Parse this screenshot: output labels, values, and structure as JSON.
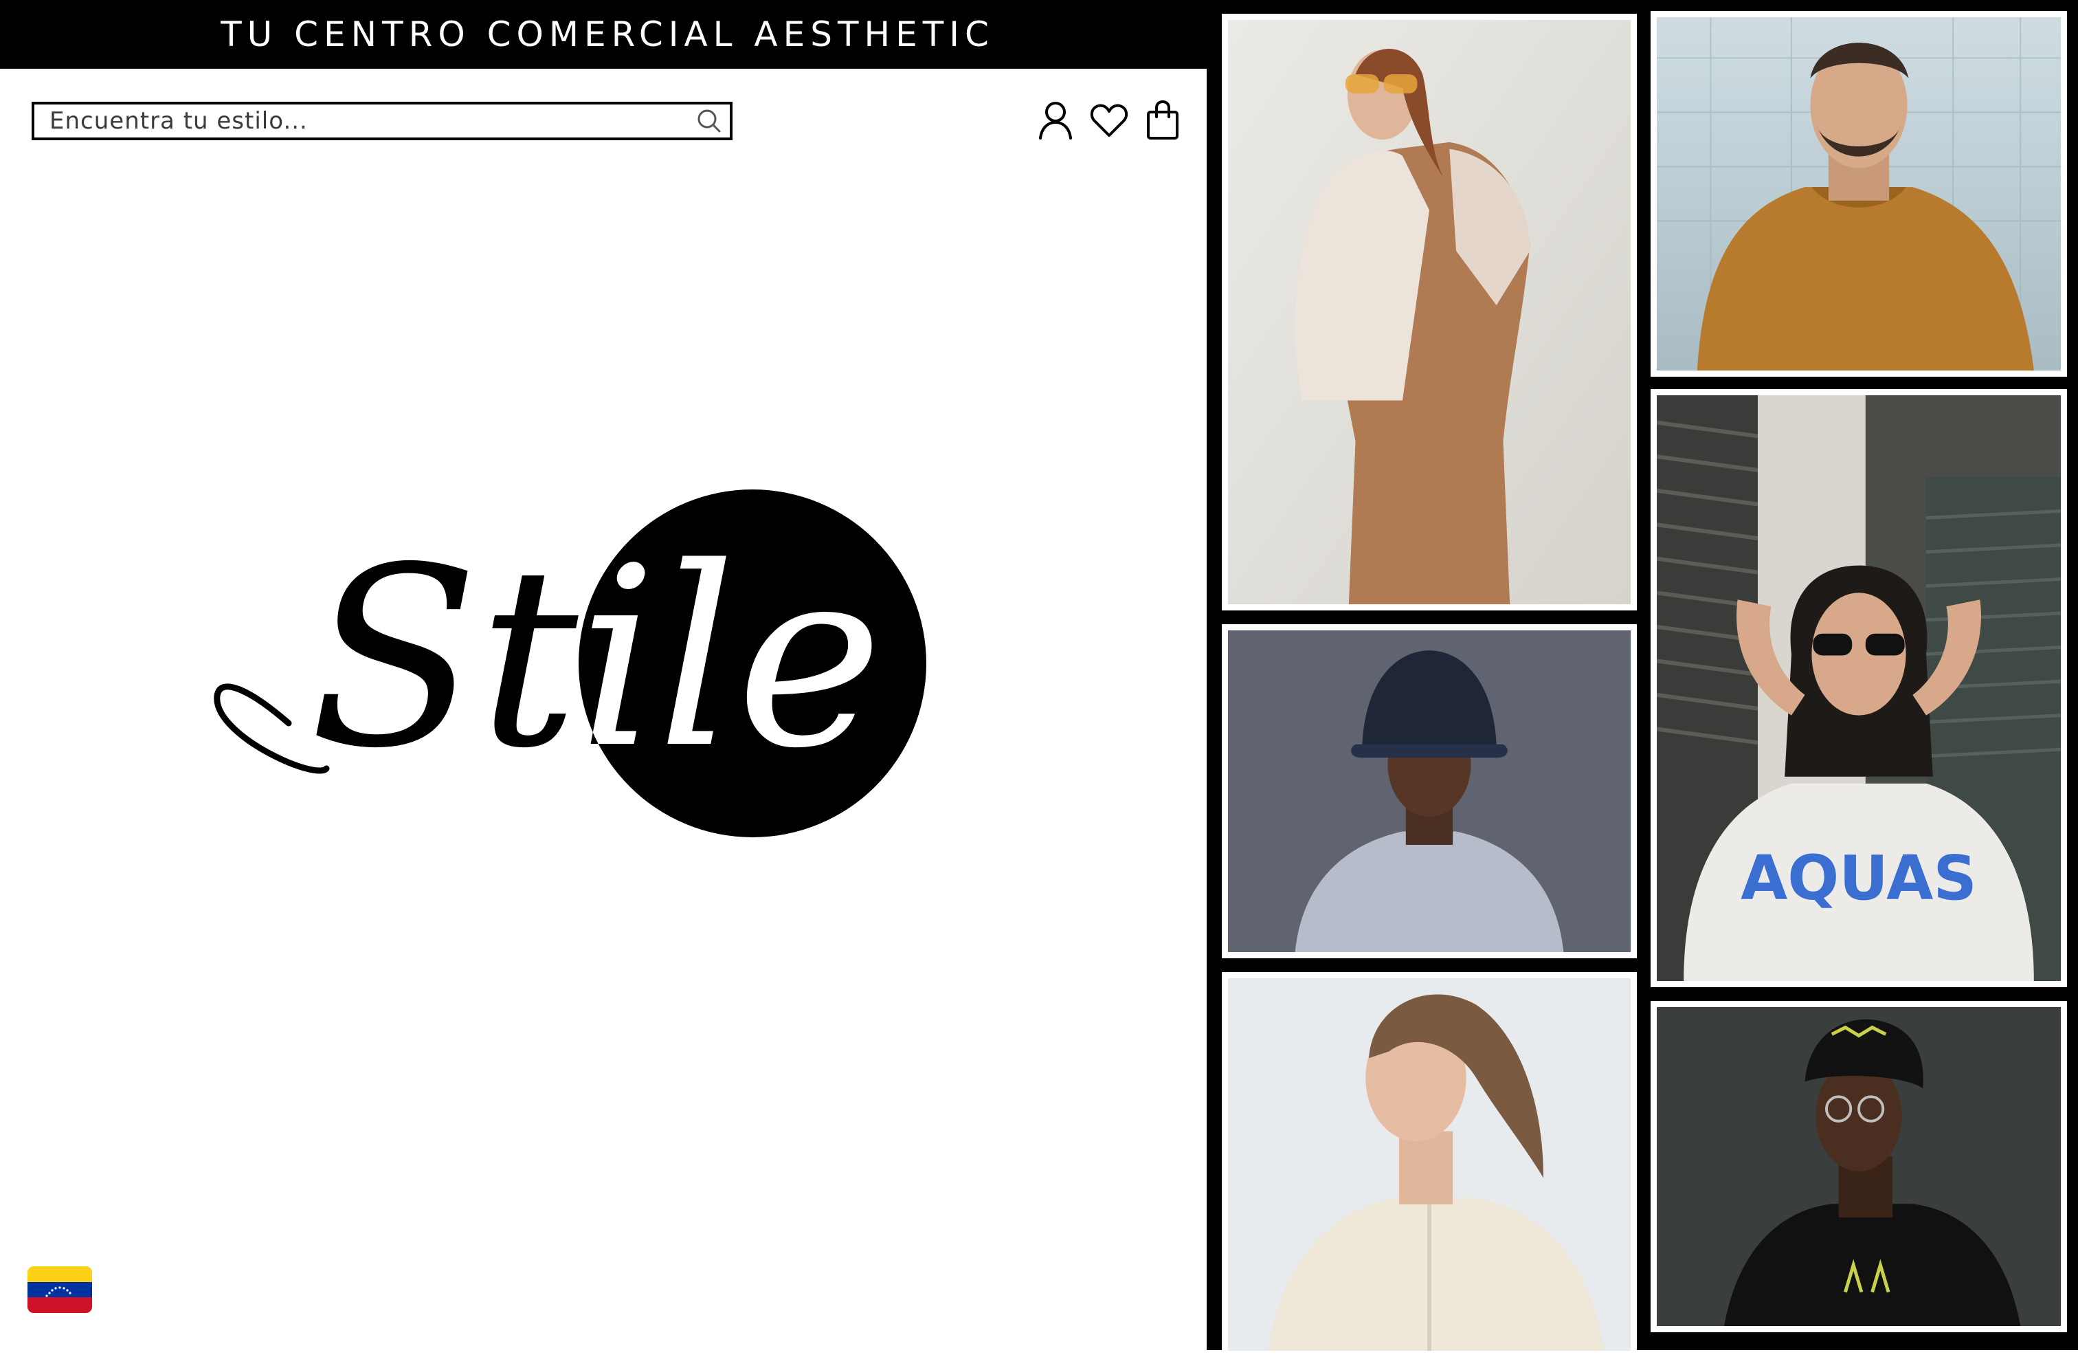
{
  "banner": {
    "text": "TU CENTRO COMERCIAL AESTHETIC"
  },
  "search": {
    "placeholder": "Encuentra tu estilo..."
  },
  "header_icons": [
    "user-icon",
    "heart-icon",
    "shopping-bag-icon"
  ],
  "logo": {
    "text": "Stile"
  },
  "locale": {
    "flag": "venezuela-flag-icon"
  },
  "colors": {
    "primary": "#000000",
    "background": "#ffffff"
  },
  "gallery": [
    "woman-sunglasses-shirt-photo",
    "man-mustard-tshirt-photo",
    "woman-sunglasses-aquas-tshirt-photo",
    "man-bucket-hat-photo",
    "woman-cream-cardigan-photo",
    "man-cap-glasses-photo"
  ]
}
